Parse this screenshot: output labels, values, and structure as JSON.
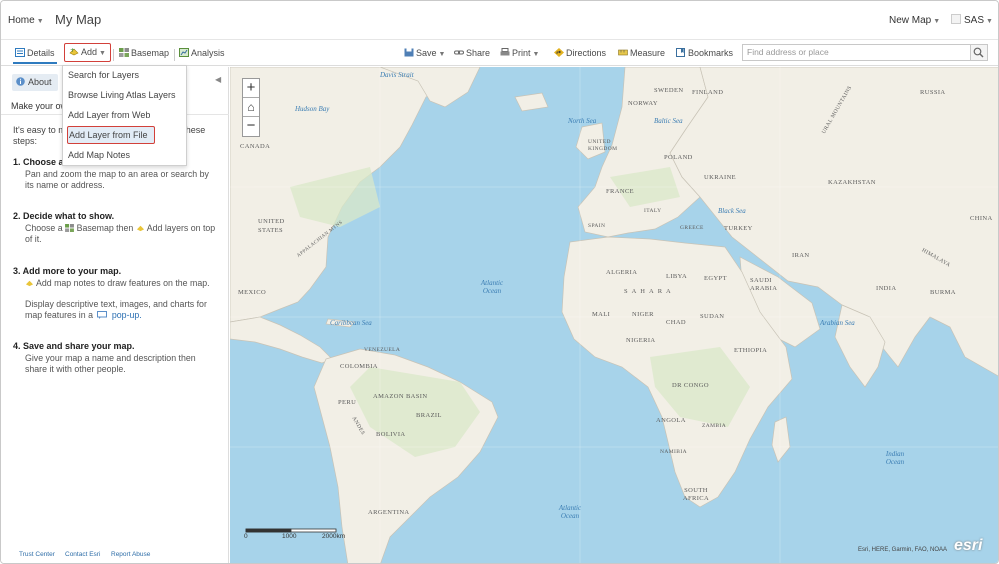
{
  "header": {
    "home_label": "Home",
    "map_title": "My Map",
    "new_map_label": "New Map",
    "user_label": "SAS"
  },
  "toolbar": {
    "details_label": "Details",
    "add_label": "Add",
    "basemap_label": "Basemap",
    "analysis_label": "Analysis",
    "save_label": "Save",
    "share_label": "Share",
    "print_label": "Print",
    "directions_label": "Directions",
    "measure_label": "Measure",
    "bookmarks_label": "Bookmarks",
    "search_placeholder": "Find address or place"
  },
  "add_menu": {
    "items": [
      "Search for Layers",
      "Browse Living Atlas Layers",
      "Add Layer from Web",
      "Add Layer from File",
      "Add Map Notes"
    ],
    "highlighted": "Add Layer from File"
  },
  "panel": {
    "about_label": "About",
    "make_yours": "Make your ow",
    "intro_line1_a": "It's easy to m",
    "intro_line1_b": "hese",
    "intro_line2": "steps:",
    "step1_title": "1. Choose ar",
    "step1_text": "Pan and zoom the map to an area or search by its name or address.",
    "step2_title": "2. Decide what to show.",
    "step2_choose": "Choose a",
    "step2_basemap": "Basemap then",
    "step2_add": "Add layers on top of it.",
    "step3_title": "3. Add more to your map.",
    "step3_text1": "Add map notes to draw features on the map.",
    "step3_text2": "Display descriptive text, images, and charts for map features in a",
    "step3_popup": "pop-up.",
    "step4_title": "4. Save and share your map.",
    "step4_text": "Give your map a name and description then share it with other people.",
    "footer_links": [
      "Trust Center",
      "Contact Esri",
      "Report Abuse"
    ]
  },
  "map": {
    "zoom_in": "+",
    "home": "⌂",
    "zoom_out": "−",
    "scale_labels": [
      "0",
      "1000",
      "2000km"
    ],
    "attribution": "Esri, HERE, Garmin, FAO, NOAA",
    "logo_text": "esri",
    "labels": {
      "canada": "CANADA",
      "united_states": "UNITED STATES",
      "mexico": "MEXICO",
      "greenland_sea": "Hudson Bay",
      "appalachian": "APPALACHIAN MTNS",
      "caribbean": "Caribbean Sea",
      "venezuela": "VENEZUELA",
      "colombia": "COLOMBIA",
      "amazon": "AMAZON BASIN",
      "brazil": "BRAZIL",
      "peru": "PERU",
      "bolivia": "BOLIVIA",
      "andes": "ANDES",
      "argentina": "ARGENTINA",
      "atlantic_n": "Atlantic Ocean",
      "atlantic_s": "Atlantic Ocean",
      "indian": "Indian Ocean",
      "sweden": "SWEDEN",
      "finland": "FINLAND",
      "norway": "NORWAY",
      "uk": "UNITED KINGDOM",
      "poland": "POLAND",
      "ukraine": "UKRAINE",
      "france": "FRANCE",
      "spain": "SPAIN",
      "italy": "ITALY",
      "greece": "GREECE",
      "turkey": "TURKEY",
      "russia": "RUSSIA",
      "kazakhstan": "KAZAKHSTAN",
      "ural": "URAL MOUNTAINS",
      "china": "CHINA",
      "himalaya": "HIMALAYA",
      "iran": "IRAN",
      "india": "INDIA",
      "burma": "BURMA",
      "algeria": "ALGERIA",
      "libya": "LIBYA",
      "egypt": "EGYPT",
      "sahara": "SAHARA",
      "saudi": "SAUDI ARABIA",
      "mali": "MALI",
      "niger": "NIGER",
      "chad": "CHAD",
      "sudan": "SUDAN",
      "nigeria": "NIGERIA",
      "ethiopia": "ETHIOPIA",
      "drc": "DR CONGO",
      "angola": "ANGOLA",
      "zambia": "ZAMBIA",
      "namibia": "NAMIBIA",
      "south_africa": "SOUTH AFRICA",
      "baltic": "Baltic Sea",
      "black": "Black Sea",
      "arabian": "Arabian Sea",
      "north_sea": "North Sea",
      "davis": "Davis Strait"
    }
  },
  "colors": {
    "ocean": "#a7d3ea",
    "land": "#f2efe6",
    "accent": "#2f7bbf",
    "highlight_border": "#d2403a"
  }
}
